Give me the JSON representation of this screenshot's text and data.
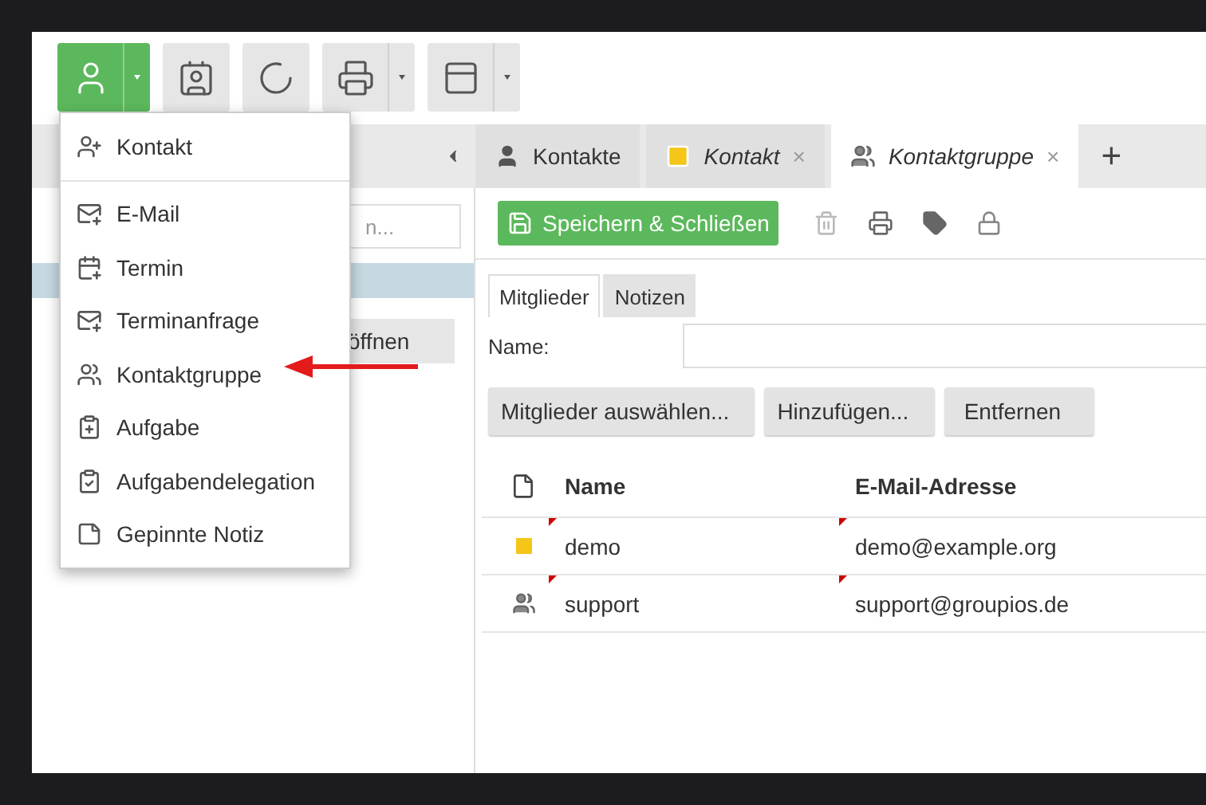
{
  "toolbar": {
    "buttons": [
      {
        "kind": "person",
        "active": true,
        "dropdown": true
      },
      {
        "kind": "addressbook",
        "active": false,
        "dropdown": false
      },
      {
        "kind": "sync",
        "active": false,
        "dropdown": false
      },
      {
        "kind": "print",
        "active": false,
        "dropdown": true
      },
      {
        "kind": "layout",
        "active": false,
        "dropdown": true
      }
    ]
  },
  "new_menu": {
    "sections": [
      {
        "items": [
          {
            "label": "Kontakt",
            "kind": "contact"
          }
        ]
      },
      {
        "items": [
          {
            "label": "E-Mail",
            "kind": "mail"
          },
          {
            "label": "Termin",
            "kind": "calendar"
          },
          {
            "label": "Terminanfrage",
            "kind": "mail"
          },
          {
            "label": "Kontaktgruppe",
            "kind": "group"
          },
          {
            "label": "Aufgabe",
            "kind": "task"
          },
          {
            "label": "Aufgabendelegation",
            "kind": "delegation"
          },
          {
            "label": "Gepinnte Notiz",
            "kind": "note"
          }
        ]
      }
    ]
  },
  "left_panel": {
    "search": {
      "placeholder": "n..."
    },
    "open_button": "öffnen"
  },
  "tabs": [
    {
      "label": "Kontakte",
      "kind": "contacts",
      "closable": false,
      "italic": false,
      "selected": false
    },
    {
      "label": "Kontakt",
      "kind": "contact",
      "closable": true,
      "italic": true,
      "selected": false
    },
    {
      "label": "Kontaktgruppe",
      "kind": "group",
      "closable": true,
      "italic": true,
      "selected": true
    }
  ],
  "tab_close": "×",
  "add_tab": "+",
  "editor": {
    "save_button": "Speichern & Schließen",
    "subtabs": [
      {
        "label": "Mitglieder",
        "selected": true
      },
      {
        "label": "Notizen",
        "selected": false
      }
    ],
    "name_label": "Name:",
    "buttons": [
      "Mitglieder auswählen...",
      "Hinzufügen...",
      "Entfernen"
    ],
    "table": {
      "columns": [
        "Name",
        "E-Mail-Adresse"
      ],
      "rows": [
        {
          "kind": "contact",
          "name": "demo",
          "email": "demo@example.org"
        },
        {
          "kind": "group",
          "name": "support",
          "email": "support@groupios.de"
        }
      ]
    }
  }
}
